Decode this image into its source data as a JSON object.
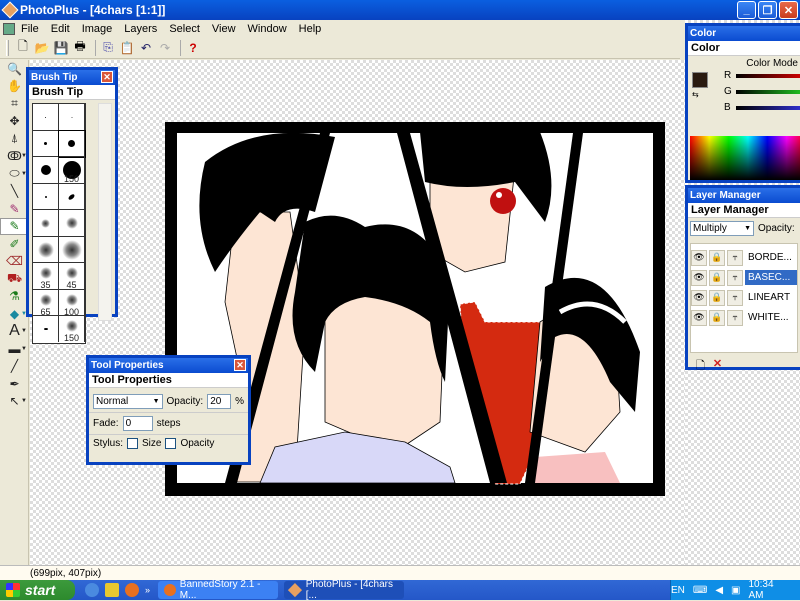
{
  "window": {
    "title": "PhotoPlus - [4chars [1:1]]"
  },
  "menu": [
    "File",
    "Edit",
    "Image",
    "Layers",
    "Select",
    "View",
    "Window",
    "Help"
  ],
  "toolbar_icons": [
    "new-icon",
    "open-icon",
    "save-icon",
    "print-icon",
    "copy-icon",
    "paste-icon",
    "undo-icon",
    "redo-icon",
    "help-icon"
  ],
  "tools": [
    "zoom-tool",
    "hand-tool",
    "crop-tool",
    "move-tool",
    "perspective-tool",
    "lasso-tool",
    "ellipse-select-tool",
    "line-tool",
    "pencil-tool",
    "brush-tool",
    "clone-tool",
    "erase-tool",
    "fill-tool",
    "dropper-tool",
    "paint-bucket-tool",
    "text-tool",
    "shape-tool",
    "straight-line-tool",
    "picker-tool",
    "pointer-tool"
  ],
  "brush_tip": {
    "title": "Brush Tip",
    "tab": "Brush Tip",
    "labels": [
      "150",
      "35",
      "45",
      "65",
      "100",
      "150"
    ]
  },
  "tool_properties": {
    "title": "Tool Properties",
    "tab": "Tool Properties",
    "blend_mode": "Normal",
    "opacity_label": "Opacity:",
    "opacity_value": "20",
    "percent": "%",
    "fade_label": "Fade:",
    "fade_value": "0",
    "steps_label": "steps",
    "stylus_label": "Stylus:",
    "size_label": "Size",
    "opacity_check_label": "Opacity"
  },
  "color_panel": {
    "title": "Color",
    "tab": "Color",
    "mode_label": "Color Mode",
    "channels": [
      "R",
      "G",
      "B"
    ],
    "foreground": "#2a1a10",
    "background": "#c8c8c8"
  },
  "layer_manager": {
    "title": "Layer Manager",
    "tab": "Layer Manager",
    "blend_mode": "Multiply",
    "opacity_label": "Opacity:",
    "layers": [
      {
        "name": "BORDE...",
        "selected": false
      },
      {
        "name": "BASEC...",
        "selected": true
      },
      {
        "name": "LINEART",
        "selected": false
      },
      {
        "name": "WHITE...",
        "selected": false
      }
    ]
  },
  "status": {
    "coords": "(699pix, 407pix)"
  },
  "taskbar": {
    "start": "start",
    "tasks": [
      "BannedStory 2.1 - M...",
      "PhotoPlus - [4chars [..."
    ],
    "lang": "EN",
    "time": "10:34 AM"
  }
}
